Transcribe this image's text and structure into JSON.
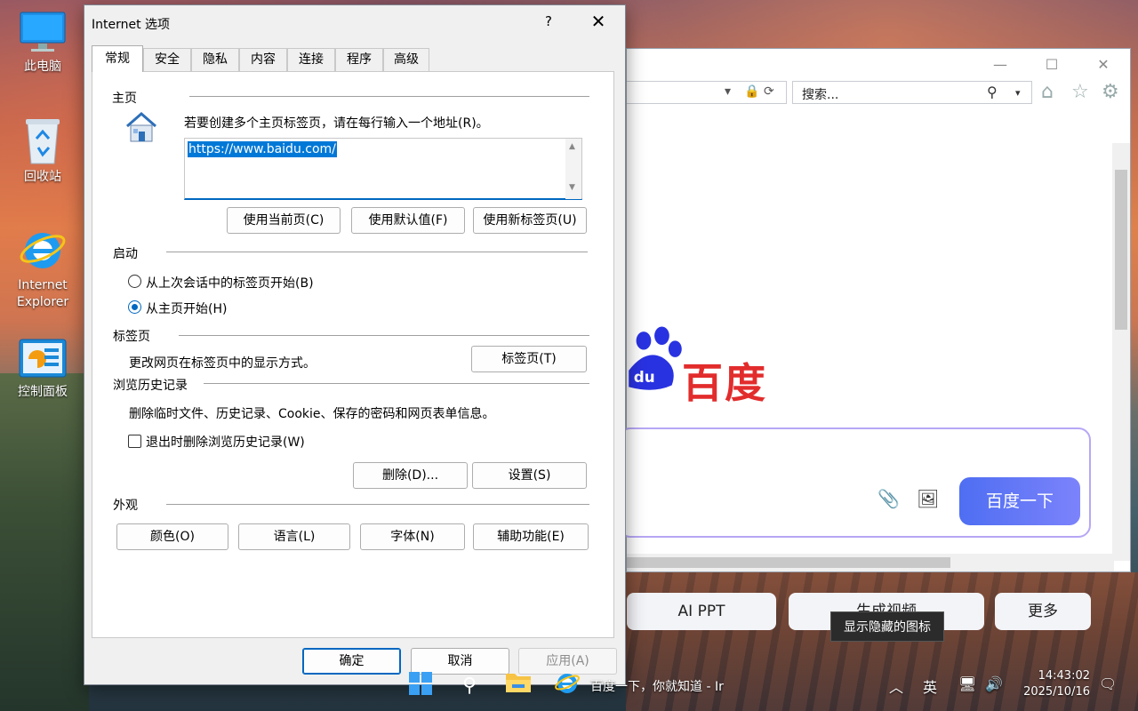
{
  "desktop": {
    "icons": [
      {
        "label": "此电脑"
      },
      {
        "label": "回收站"
      },
      {
        "label_line1": "Internet",
        "label_line2": "Explorer"
      },
      {
        "label": "控制面板"
      }
    ]
  },
  "browser": {
    "search_placeholder": "搜索...",
    "baidu_brand": "百度",
    "search_button": "百度一下",
    "quick_links": [
      "AI PPT",
      "生成视频",
      "更多"
    ]
  },
  "dialog": {
    "title": "Internet 选项",
    "help_label": "?",
    "close_label": "✕",
    "tabs": [
      "常规",
      "安全",
      "隐私",
      "内容",
      "连接",
      "程序",
      "高级"
    ],
    "homepage": {
      "title": "主页",
      "description": "若要创建多个主页标签页，请在每行输入一个地址(R)。",
      "url": "https://www.baidu.com/",
      "btn_current": "使用当前页(C)",
      "btn_default": "使用默认值(F)",
      "btn_newtab": "使用新标签页(U)"
    },
    "startup": {
      "title": "启动",
      "option_last_session": "从上次会话中的标签页开始(B)",
      "option_homepage": "从主页开始(H)",
      "selected": "option_homepage"
    },
    "tabs_section": {
      "title": "标签页",
      "description": "更改网页在标签页中的显示方式。",
      "button": "标签页(T)"
    },
    "history": {
      "title": "浏览历史记录",
      "description": "删除临时文件、历史记录、Cookie、保存的密码和网页表单信息。",
      "checkbox_label": "退出时删除浏览历史记录(W)",
      "checkbox_checked": false,
      "btn_delete": "删除(D)...",
      "btn_settings": "设置(S)"
    },
    "appearance": {
      "title": "外观",
      "btn_colors": "颜色(O)",
      "btn_languages": "语言(L)",
      "btn_fonts": "字体(N)",
      "btn_accessibility": "辅助功能(E)"
    },
    "footer": {
      "ok": "确定",
      "cancel": "取消",
      "apply": "应用(A)"
    }
  },
  "tooltip": "显示隐藏的图标",
  "taskbar": {
    "ie_window_title": "百度一下，你就知道 - Ir",
    "ime": "英",
    "time": "14:43:02",
    "date": "2025/10/16"
  }
}
